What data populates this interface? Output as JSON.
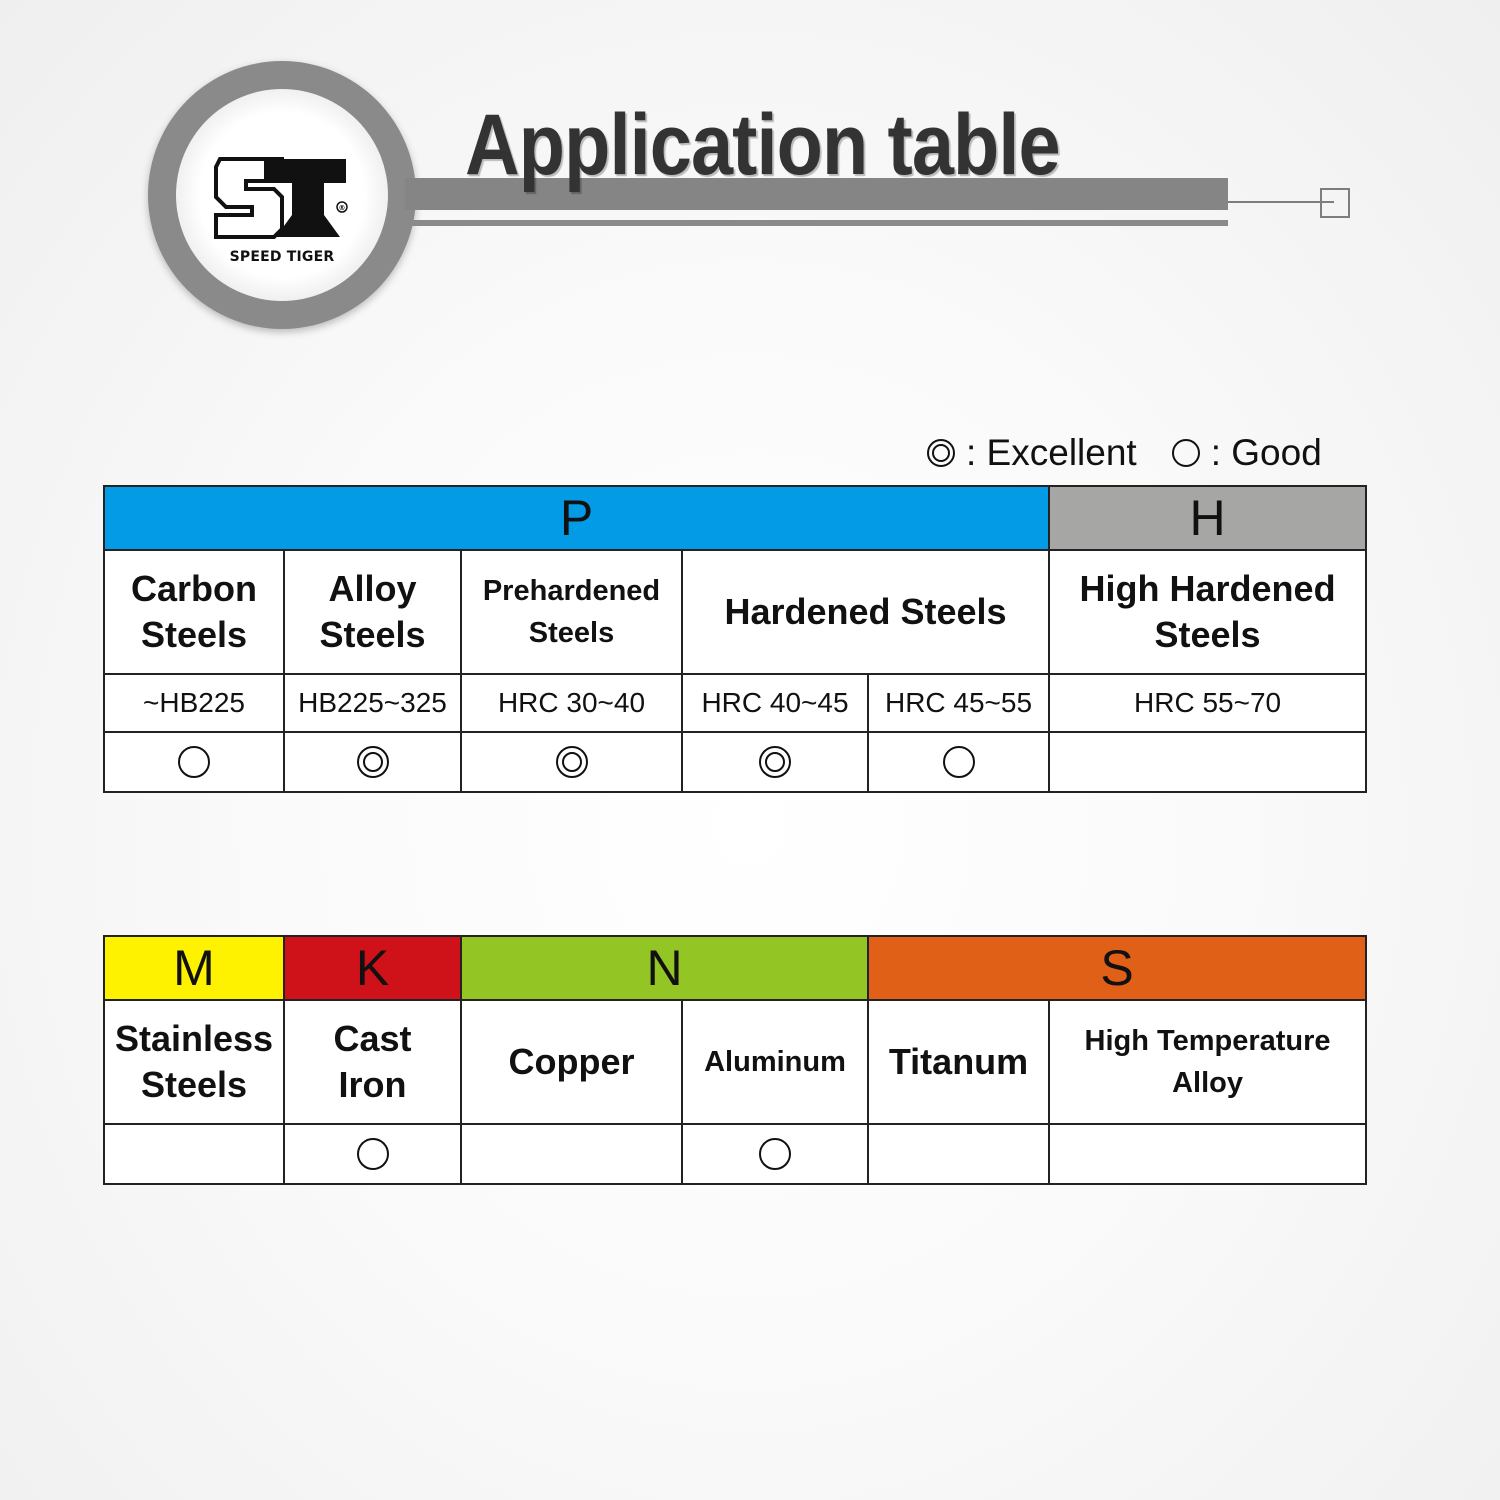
{
  "header": {
    "logo_text": "SPEED TIGER",
    "registered_mark": "®",
    "title": "Application table"
  },
  "legend": {
    "excellent": {
      "icon": "double-circle-icon",
      "label": ": Excellent"
    },
    "good": {
      "icon": "circle-icon",
      "label": ": Good"
    }
  },
  "colors": {
    "P": "#039be5",
    "H": "#a6a6a4",
    "M": "#fff200",
    "K": "#cf1119",
    "N": "#93c524",
    "S": "#e06017"
  },
  "table_top": {
    "groups": [
      {
        "code": "P",
        "label": "P"
      },
      {
        "code": "H",
        "label": "H"
      }
    ],
    "materials": [
      {
        "name": "Carbon\nSteels",
        "range": "~HB225",
        "rating": "good"
      },
      {
        "name": "Alloy\nSteels",
        "range": "HB225~325",
        "rating": "excellent"
      },
      {
        "name": "Prehardened\nSteels",
        "range": "HRC 30~40",
        "rating": "excellent"
      },
      {
        "name": "Hardened Steels",
        "ranges": [
          "HRC 40~45",
          "HRC 45~55"
        ],
        "ratings": [
          "excellent",
          "good"
        ]
      },
      {
        "name": "High Hardened\nSteels",
        "range": "HRC 55~70",
        "rating": "none"
      }
    ]
  },
  "table_bottom": {
    "groups": [
      {
        "code": "M",
        "label": "M"
      },
      {
        "code": "K",
        "label": "K"
      },
      {
        "code": "N",
        "label": "N"
      },
      {
        "code": "S",
        "label": "S"
      }
    ],
    "materials": [
      {
        "name": "Stainless\nSteels",
        "rating": "none"
      },
      {
        "name": "Cast\nIron",
        "rating": "good"
      },
      {
        "name": "Copper",
        "rating": "none"
      },
      {
        "name": "Aluminum",
        "rating": "good"
      },
      {
        "name": "Titanum",
        "rating": "none"
      },
      {
        "name": "High Temperature\nAlloy",
        "rating": "none"
      }
    ]
  }
}
